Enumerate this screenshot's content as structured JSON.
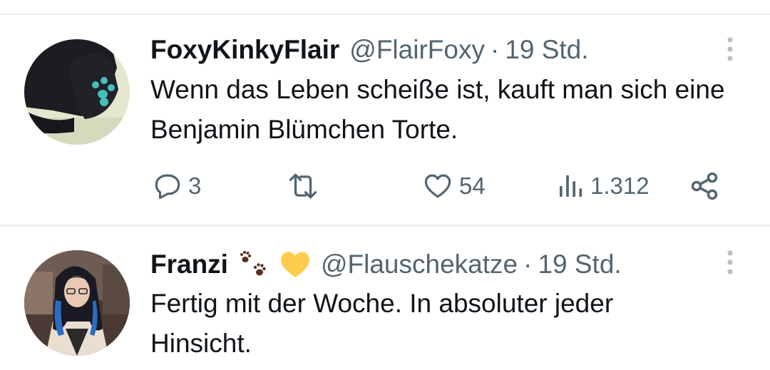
{
  "tweets": [
    {
      "display_name": "FoxyKinkyFlair",
      "handle": "@FlairFoxy",
      "separator": "·",
      "time": "19 Std.",
      "text": "Wenn das Leben scheiße ist, kauft man sich eine Benjamin Blümchen Torte.",
      "replies": "3",
      "retweets": "",
      "likes": "54",
      "views": "1.312"
    },
    {
      "display_name": "Franzi",
      "handle": "@Flauschekatze",
      "separator": "·",
      "time": "19 Std.",
      "text": "Fertig mit der Woche. In absoluter jeder Hinsicht.",
      "name_emojis": [
        "paw-prints",
        "yellow-heart"
      ]
    }
  ],
  "icons": {
    "reply": "speech-bubble-icon",
    "retweet": "retweet-icon",
    "like": "heart-icon",
    "views": "bar-chart-icon",
    "share": "share-icon",
    "more": "vertical-dots-icon"
  },
  "colors": {
    "text": "#0f1419",
    "secondary": "#536471",
    "divider": "#e6ebee",
    "heart_emoji": "#ffcc4d",
    "paw_emoji": "#5c2e1e"
  }
}
